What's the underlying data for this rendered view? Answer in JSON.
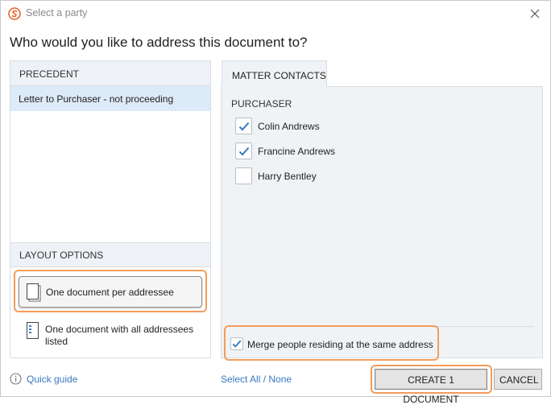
{
  "window": {
    "title": "Select a party",
    "heading": "Who would you like to address this document to?"
  },
  "precedent": {
    "header": "PRECEDENT",
    "items": [
      {
        "label": "Letter to Purchaser - not proceeding",
        "selected": true
      }
    ]
  },
  "layout_options": {
    "header": "LAYOUT OPTIONS",
    "options": [
      {
        "label": "One document per addressee",
        "selected": true
      },
      {
        "label_line1": "One document with all addressees",
        "label_line2": "listed",
        "selected": false
      }
    ]
  },
  "matter_contacts": {
    "tab_label": "MATTER CONTACTS",
    "group_label": "PURCHASER",
    "contacts": [
      {
        "name": "Colin Andrews",
        "checked": true
      },
      {
        "name": "Francine Andrews",
        "checked": true
      },
      {
        "name": "Harry Bentley",
        "checked": false
      }
    ],
    "merge_label": "Merge people residing at the same address",
    "merge_checked": true
  },
  "footer": {
    "quick_guide": "Quick guide",
    "select_all": "Select All",
    "separator": " / ",
    "select_none": "None",
    "create_button": "CREATE 1 DOCUMENT",
    "cancel_button": "CANCEL"
  },
  "colors": {
    "accent_blue": "#3a78c3",
    "highlight_orange": "#f39c5a",
    "selection_blue": "#ddeaf7",
    "brand_orange": "#e8642c"
  },
  "icons": {
    "app": "app-logo-icon",
    "close": "close-icon",
    "single_doc": "single-document-icon",
    "multi_doc": "list-document-icon",
    "info": "info-icon",
    "check": "checkmark-icon"
  }
}
